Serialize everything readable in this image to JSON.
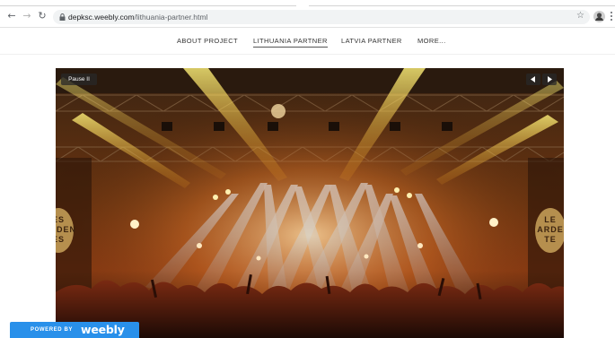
{
  "browser": {
    "url_host": "depksc.weebly.com",
    "url_path": "/lithuania-partner.html",
    "back_icon": "back-arrow-icon",
    "forward_icon": "forward-arrow-icon",
    "reload_icon": "reload-icon",
    "lock_icon": "lock-icon",
    "bookmark_icon": "star-icon",
    "menu_icon": "kebab-menu-icon"
  },
  "nav": {
    "items": [
      {
        "label": "ABOUT PROJECT",
        "active": false
      },
      {
        "label": "LITHUANIA PARTNER",
        "active": true
      },
      {
        "label": "LATVIA PARTNER",
        "active": false
      },
      {
        "label": "MORE...",
        "active": false
      }
    ]
  },
  "slideshow": {
    "pause_label": "Pause II",
    "prev_icon": "chevron-left-icon",
    "next_icon": "chevron-right-icon",
    "sign_left": "ES\nARDEN\nES",
    "sign_right": "LE\nARDE\nTE"
  },
  "badge": {
    "powered_label": "POWERED BY",
    "brand_label": "weebly"
  },
  "colors": {
    "badge_blue": "#2990ea",
    "omnibox_bg": "#f1f3f4",
    "stage_warm": "#f0a020",
    "stage_cool": "#bcd8f0"
  }
}
